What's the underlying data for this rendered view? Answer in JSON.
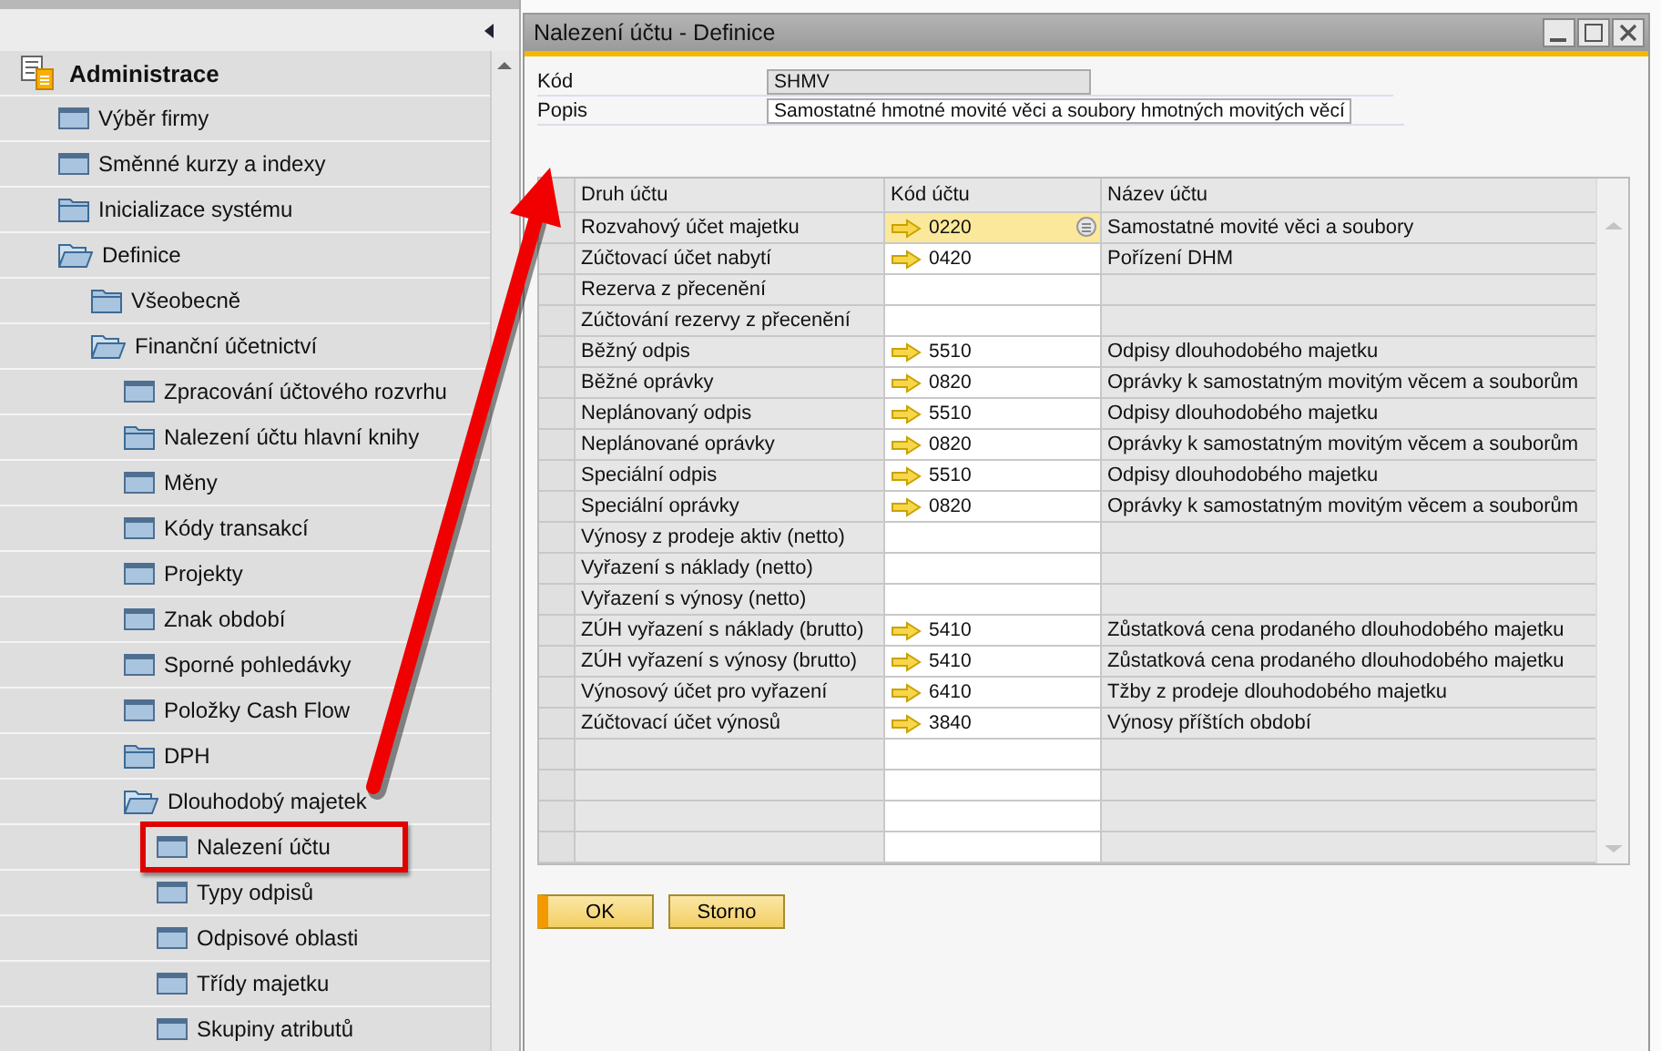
{
  "sidebar": {
    "tree": [
      {
        "label": "Administrace",
        "kind": "module",
        "highlighted": false,
        "children": [
          {
            "label": "Výběr firmy",
            "kind": "form",
            "highlighted": false
          },
          {
            "label": "Směnné kurzy a indexy",
            "kind": "form",
            "highlighted": false
          },
          {
            "label": "Inicializace systému",
            "kind": "folder",
            "expanded": false,
            "highlighted": false
          },
          {
            "label": "Definice",
            "kind": "folder",
            "expanded": true,
            "highlighted": false,
            "children": [
              {
                "label": "Všeobecně",
                "kind": "folder",
                "expanded": false,
                "highlighted": false
              },
              {
                "label": "Finanční účetnictví",
                "kind": "folder",
                "expanded": true,
                "highlighted": false,
                "children": [
                  {
                    "label": "Zpracování účtového rozvrhu",
                    "kind": "form",
                    "highlighted": false
                  },
                  {
                    "label": "Nalezení účtu hlavní knihy",
                    "kind": "folder",
                    "expanded": false,
                    "highlighted": false
                  },
                  {
                    "label": "Měny",
                    "kind": "form",
                    "highlighted": false
                  },
                  {
                    "label": "Kódy transakcí",
                    "kind": "form",
                    "highlighted": false
                  },
                  {
                    "label": "Projekty",
                    "kind": "form",
                    "highlighted": false
                  },
                  {
                    "label": "Znak období",
                    "kind": "form",
                    "highlighted": false
                  },
                  {
                    "label": "Sporné pohledávky",
                    "kind": "form",
                    "highlighted": false
                  },
                  {
                    "label": "Položky Cash Flow",
                    "kind": "form",
                    "highlighted": false
                  },
                  {
                    "label": "DPH",
                    "kind": "folder",
                    "expanded": false,
                    "highlighted": false
                  },
                  {
                    "label": "Dlouhodobý majetek",
                    "kind": "folder",
                    "expanded": true,
                    "highlighted": false,
                    "children": [
                      {
                        "label": "Nalezení účtu",
                        "kind": "form",
                        "highlighted": true
                      },
                      {
                        "label": "Typy odpisů",
                        "kind": "form",
                        "highlighted": false
                      },
                      {
                        "label": "Odpisové oblasti",
                        "kind": "form",
                        "highlighted": false
                      },
                      {
                        "label": "Třídy majetku",
                        "kind": "form",
                        "highlighted": false
                      },
                      {
                        "label": "Skupiny atributů",
                        "kind": "form",
                        "highlighted": false
                      }
                    ]
                  }
                ]
              }
            ]
          }
        ]
      }
    ]
  },
  "window": {
    "title": "Nalezení účtu - Definice",
    "fields": [
      {
        "label": "Kód",
        "value": "SHMV",
        "disabled": true
      },
      {
        "label": "Popis",
        "value": "Samostatné hmotné movité věci a soubory hmotných movitých věcí",
        "disabled": false
      }
    ],
    "grid": {
      "columns": [
        "Druh účtu",
        "Kód účtu",
        "Název účtu"
      ],
      "rows": [
        {
          "type": "Rozvahový účet majetku",
          "code": "0220",
          "name": "Samostatné movité věci a soubory",
          "selected": true
        },
        {
          "type": "Zúčtovací účet nabytí",
          "code": "0420",
          "name": "Pořízení DHM",
          "selected": false
        },
        {
          "type": "Rezerva z přecenění",
          "selected": false
        },
        {
          "type": "Zúčtování rezervy z přecenění",
          "selected": false
        },
        {
          "type": "Běžný odpis",
          "code": "5510",
          "name": "Odpisy dlouhodobého majetku",
          "selected": false
        },
        {
          "type": "Běžné oprávky",
          "code": "0820",
          "name": "Oprávky k samostatným movitým věcem a souborům",
          "selected": false
        },
        {
          "type": "Neplánovaný odpis",
          "code": "5510",
          "name": "Odpisy dlouhodobého majetku",
          "selected": false
        },
        {
          "type": "Neplánované oprávky",
          "code": "0820",
          "name": "Oprávky k samostatným movitým věcem a souborům",
          "selected": false
        },
        {
          "type": "Speciální odpis",
          "code": "5510",
          "name": "Odpisy dlouhodobého majetku",
          "selected": false
        },
        {
          "type": "Speciální oprávky",
          "code": "0820",
          "name": "Oprávky k samostatným movitým věcem a souborům",
          "selected": false
        },
        {
          "type": "Výnosy z prodeje aktiv (netto)",
          "selected": false
        },
        {
          "type": "Vyřazení s náklady (netto)",
          "selected": false
        },
        {
          "type": "Vyřazení s výnosy (netto)",
          "selected": false
        },
        {
          "type": "ZÚH vyřazení s náklady (brutto)",
          "code": "5410",
          "name": "Zůstatková cena prodaného dlouhodobého majetku",
          "selected": false
        },
        {
          "type": "ZÚH vyřazení s výnosy (brutto)",
          "code": "5410",
          "name": "Zůstatková cena prodaného dlouhodobého majetku",
          "selected": false
        },
        {
          "type": "Výnosový účet pro vyřazení",
          "code": "6410",
          "name": "Tžby z prodeje dlouhodobého majetku",
          "selected": false
        },
        {
          "type": "Zúčtovací účet výnosů",
          "code": "3840",
          "name": "Výnosy příštích období",
          "selected": false
        }
      ]
    },
    "buttons": [
      {
        "label": "OK",
        "default": true
      },
      {
        "label": "Storno",
        "default": false
      }
    ]
  }
}
